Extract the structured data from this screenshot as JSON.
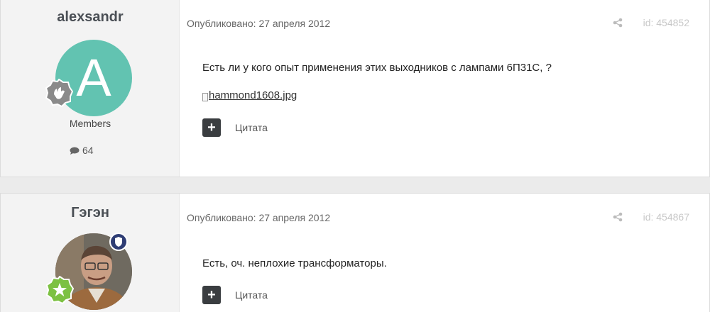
{
  "posts": [
    {
      "author": "alexsandr",
      "avatar_letter": "A",
      "group": "Members",
      "post_count": "64",
      "published": "Опубликовано: 27 апреля 2012",
      "id_label": "id: 454852",
      "text": "Есть ли у кого опыт применения этих выходников с лампами 6П31С, ?",
      "attachment": "hammond1608.jpg",
      "quote_label": "Цитата",
      "plus": "+"
    },
    {
      "author": "Гэгэн",
      "published": "Опубликовано: 27 апреля 2012",
      "id_label": "id: 454867",
      "text": "Есть, оч. неплохие трансформаторы.",
      "quote_label": "Цитата",
      "plus": "+"
    }
  ],
  "colors": {
    "avatar_bg": "#62c3b1",
    "mod_badge": "#2e3d74",
    "button": "#3a3d40",
    "star_badge": "#7cc142"
  },
  "icons": [
    "rank-badge-icon",
    "speech-bubble-icon",
    "share-icon",
    "plus-icon",
    "moderator-badge-icon",
    "star-badge-icon"
  ]
}
